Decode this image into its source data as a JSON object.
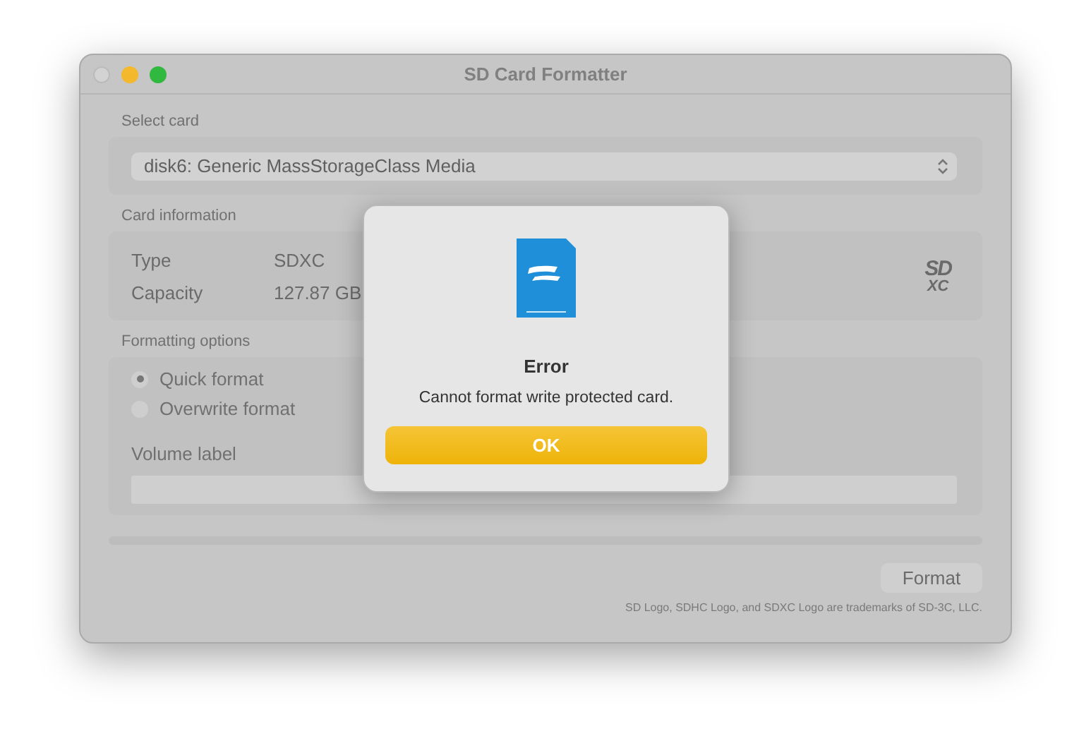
{
  "window": {
    "title": "SD Card Formatter"
  },
  "select_card": {
    "label": "Select card",
    "value": "disk6: Generic MassStorageClass Media"
  },
  "card_information": {
    "label": "Card information",
    "rows": [
      {
        "name": "Type",
        "value": "SDXC"
      },
      {
        "name": "Capacity",
        "value": "127.87 GB"
      }
    ],
    "logo": {
      "top": "SD",
      "bottom": "XC"
    }
  },
  "formatting_options": {
    "label": "Formatting options",
    "options": [
      {
        "label": "Quick format",
        "selected": true
      },
      {
        "label": "Overwrite format",
        "selected": false
      }
    ],
    "volume_label": {
      "label": "Volume label"
    }
  },
  "format_button": "Format",
  "footer": "SD Logo, SDHC Logo, and SDXC Logo are trademarks of SD-3C, LLC.",
  "dialog": {
    "title": "Error",
    "message": "Cannot format write protected card.",
    "button": "OK"
  }
}
